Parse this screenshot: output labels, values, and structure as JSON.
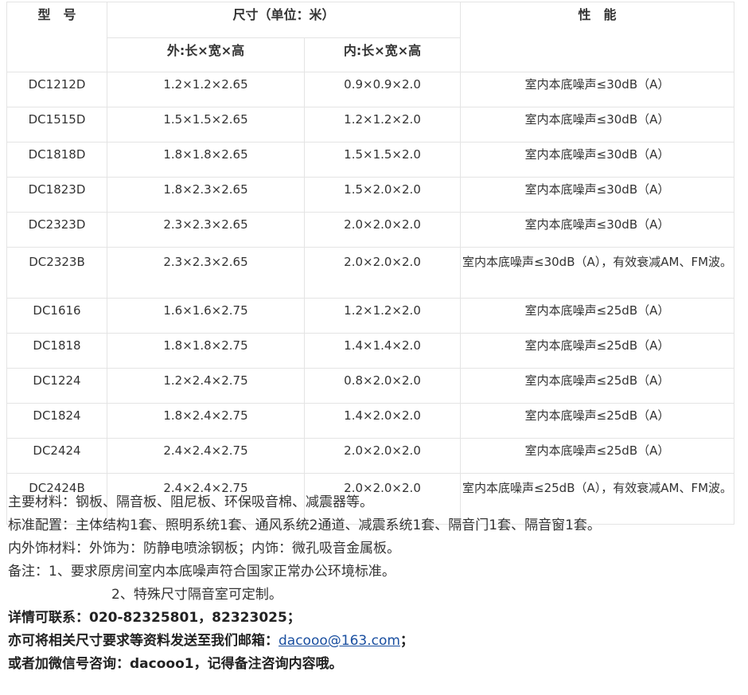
{
  "table": {
    "header": {
      "model": "型　号",
      "size_group": "尺寸（单位：米）",
      "performance": "性　能",
      "outer": "外:长×宽×高",
      "inner": "内:长×宽×高"
    },
    "rows": [
      {
        "model": "DC1212D",
        "outer": "1.2×1.2×2.65",
        "inner": "0.9×0.9×2.0",
        "perf": "室内本底噪声≤30dB（A）"
      },
      {
        "model": "DC1515D",
        "outer": "1.5×1.5×2.65",
        "inner": "1.2×1.2×2.0",
        "perf": "室内本底噪声≤30dB（A）"
      },
      {
        "model": "DC1818D",
        "outer": "1.8×1.8×2.65",
        "inner": "1.5×1.5×2.0",
        "perf": "室内本底噪声≤30dB（A）"
      },
      {
        "model": "DC1823D",
        "outer": "1.8×2.3×2.65",
        "inner": "1.5×2.0×2.0",
        "perf": "室内本底噪声≤30dB（A）"
      },
      {
        "model": "DC2323D",
        "outer": "2.3×2.3×2.65",
        "inner": "2.0×2.0×2.0",
        "perf": "室内本底噪声≤30dB（A）"
      },
      {
        "model": "DC2323B",
        "outer": "2.3×2.3×2.65",
        "inner": "2.0×2.0×2.0",
        "perf": "室内本底噪声≤30dB（A），有效衰减AM、FM波。"
      },
      {
        "model": "DC1616",
        "outer": "1.6×1.6×2.75",
        "inner": "1.2×1.2×2.0",
        "perf": "室内本底噪声≤25dB（A）"
      },
      {
        "model": "DC1818",
        "outer": "1.8×1.8×2.75",
        "inner": "1.4×1.4×2.0",
        "perf": "室内本底噪声≤25dB（A）"
      },
      {
        "model": "DC1224",
        "outer": "1.2×2.4×2.75",
        "inner": "0.8×2.0×2.0",
        "perf": "室内本底噪声≤25dB（A）"
      },
      {
        "model": "DC1824",
        "outer": "1.8×2.4×2.75",
        "inner": "1.4×2.0×2.0",
        "perf": "室内本底噪声≤25dB（A）"
      },
      {
        "model": "DC2424",
        "outer": "2.4×2.4×2.75",
        "inner": "2.0×2.0×2.0",
        "perf": "室内本底噪声≤25dB（A）"
      },
      {
        "model": "DC2424B",
        "outer": "2.4×2.4×2.75",
        "inner": "2.0×2.0×2.0",
        "perf": "室内本底噪声≤25dB（A），有效衰减AM、FM波。"
      }
    ]
  },
  "notes": {
    "materials": "主要材料：钢板、隔音板、阻尼板、环保吸音棉、减震器等。",
    "config": "标准配置：主体结构1套、照明系统1套、通风系统2通道、减震系统1套、隔音门1套、隔音窗1套。",
    "finish": "内外饰材料：外饰为：防静电喷涂钢板；内饰：微孔吸音金属板。",
    "remark1": "备注：1、要求原房间室内本底噪声符合国家正常办公环境标准。",
    "remark2": "2、特殊尺寸隔音室可定制。",
    "contact": "详情可联系：020-82325801，82323025；",
    "email_prefix": "亦可将相关尺寸要求等资料发送至我们邮箱：",
    "email": "dacooo@163.com",
    "email_suffix": "；",
    "wechat": "或者加微信号咨询：dacooo1，记得备注咨询内容哦。"
  }
}
